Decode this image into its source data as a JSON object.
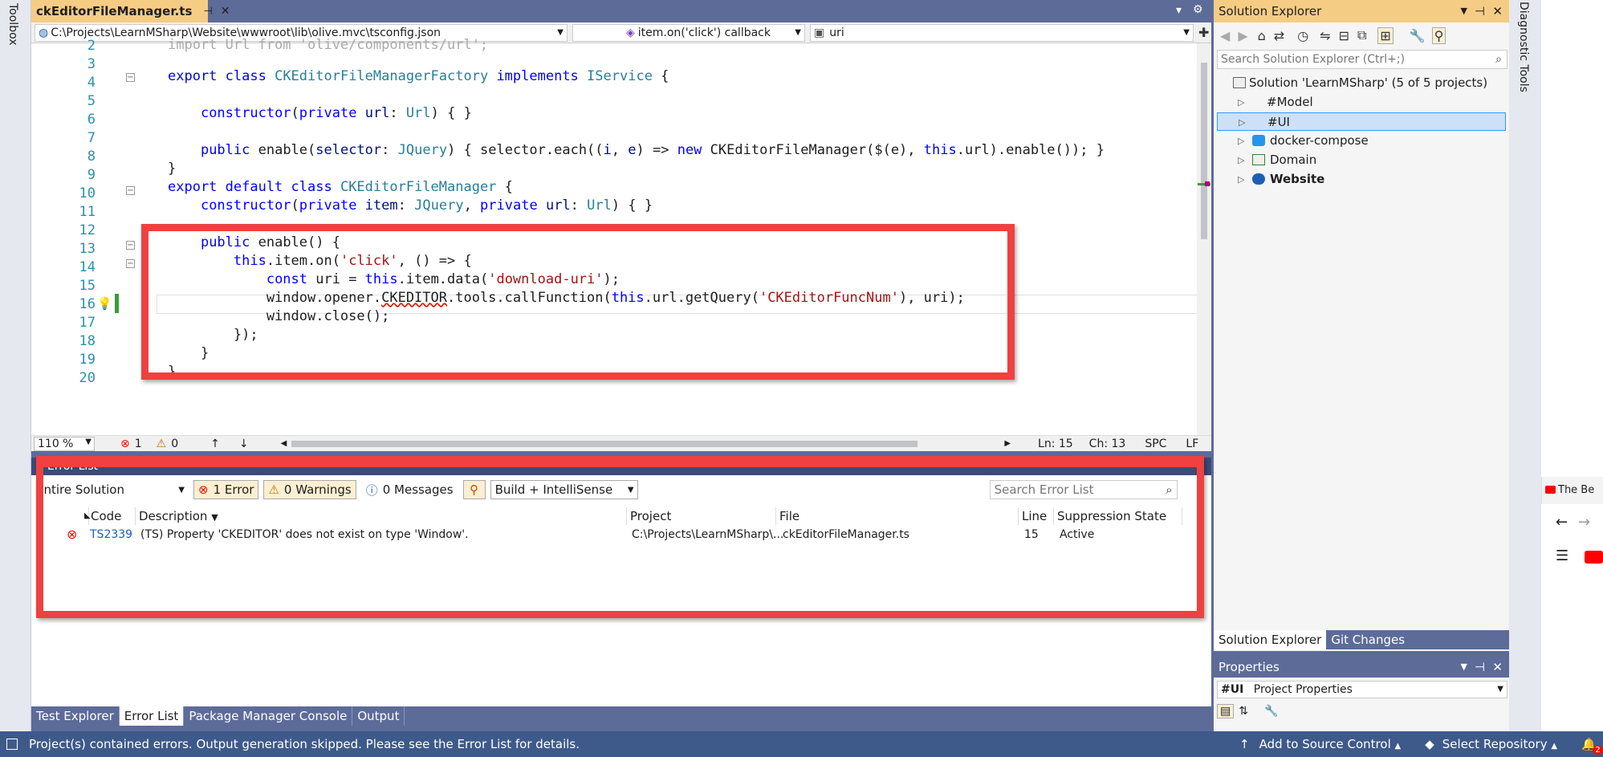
{
  "toolbox": {
    "label": "Toolbox"
  },
  "diagnostic": {
    "label": "Diagnostic Tools"
  },
  "doc_tab": {
    "title": "ckEditorFileManager.ts",
    "pin": "⊣",
    "close": "✕"
  },
  "tabbar_right": {
    "dropdown": "▾",
    "settings": "⚙"
  },
  "navbar": {
    "path": "C:\\Projects\\LearnMSharp\\Website\\wwwroot\\lib\\olive.mvc\\tsconfig.json",
    "member": "item.on('click') callback",
    "symbol": "uri"
  },
  "editor": {
    "top_partial": "import Url from 'olive/components/url';",
    "line_numbers": [
      "2",
      "3",
      "4",
      "5",
      "6",
      "7",
      "8",
      "9",
      "10",
      "11",
      "12",
      "13",
      "14",
      "15",
      "16",
      "17",
      "18",
      "19",
      "20"
    ],
    "zoom": "110 %",
    "errors_count": "1",
    "warnings_count": "0",
    "ln": "Ln: 15",
    "ch": "Ch: 13",
    "spc": "SPC",
    "lf": "LF"
  },
  "error_list": {
    "title": "Error List",
    "scope": "Entire Solution",
    "errors_btn": "1 Error",
    "warnings_btn": "0 Warnings",
    "messages_btn": "0 Messages",
    "build_filter": "Build + IntelliSense",
    "search_placeholder": "Search Error List",
    "headers": {
      "code": "Code",
      "description": "Description",
      "project": "Project",
      "file": "File",
      "line": "Line",
      "suppression": "Suppression State"
    },
    "rows": [
      {
        "code": "TS2339",
        "description": "(TS) Property 'CKEDITOR' does not exist on type 'Window'.",
        "project": "C:\\Projects\\LearnMSharp\\...",
        "file": "ckEditorFileManager.ts",
        "line": "15",
        "suppression": "Active"
      }
    ]
  },
  "bottom_tabs": [
    "Test Explorer",
    "Error List",
    "Package Manager Console",
    "Output"
  ],
  "status_bar": {
    "message": "Project(s) contained errors. Output generation skipped. Please see the Error List for details.",
    "source_control": "Add to Source Control",
    "repository": "Select Repository",
    "notifications": "2"
  },
  "solution_explorer": {
    "title": "Solution Explorer",
    "search_placeholder": "Search Solution Explorer (Ctrl+;)",
    "items": [
      {
        "label": "Solution 'LearnMSharp' (5 of 5 projects)"
      },
      {
        "label": "#Model"
      },
      {
        "label": "#UI"
      },
      {
        "label": "docker-compose"
      },
      {
        "label": "Domain"
      },
      {
        "label": "Website"
      }
    ],
    "tabs": [
      "Solution Explorer",
      "Git Changes"
    ]
  },
  "properties": {
    "title": "Properties",
    "object": "#UI",
    "object_type": "Project Properties"
  },
  "browser": {
    "tab_title": "The Be"
  },
  "colors": {
    "accent_tab": "#f5cc84",
    "chrome": "#5d6b99",
    "highlight_red": "#f04040",
    "error": "#e51400"
  }
}
